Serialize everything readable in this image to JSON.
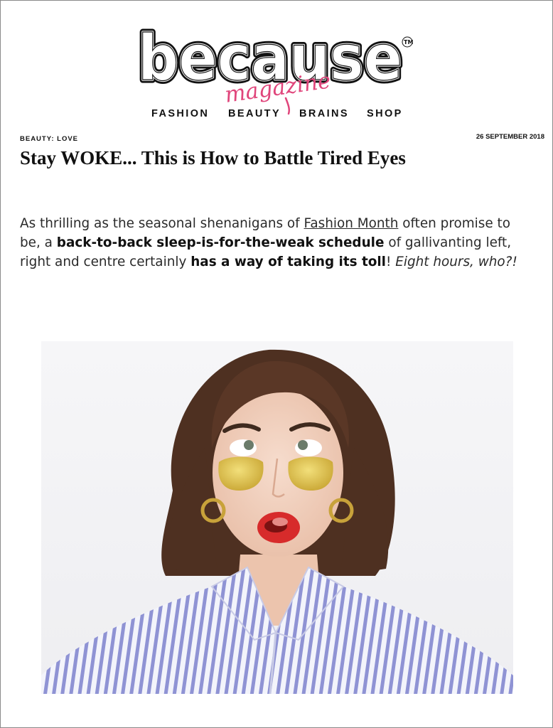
{
  "brand": {
    "name": "because",
    "sub": "magazine",
    "trademark": "TM",
    "accent": "#e0457b"
  },
  "nav": {
    "items": [
      {
        "label": "FASHION"
      },
      {
        "label": "BEAUTY"
      },
      {
        "label": "BRAINS"
      },
      {
        "label": "SHOP"
      }
    ]
  },
  "article": {
    "category": "BEAUTY: LOVE",
    "date": "26 SEPTEMBER 2018",
    "title": "Stay WOKE... This is How to Battle Tired Eyes",
    "intro": {
      "t1": "As thrilling as the seasonal shenanigans of ",
      "link": "Fashion Month",
      "t2": " often promise to be, a ",
      "b1": "back-to-back sleep-is-for-the-weak schedule",
      "t3": " of gallivanting left, right and centre certainly ",
      "b2": "has a way of taking its toll",
      "t4": "! ",
      "i1": "Eight hours, who?!"
    },
    "hero_image": {
      "subject": "woman-wearing-gold-under-eye-patches"
    }
  }
}
